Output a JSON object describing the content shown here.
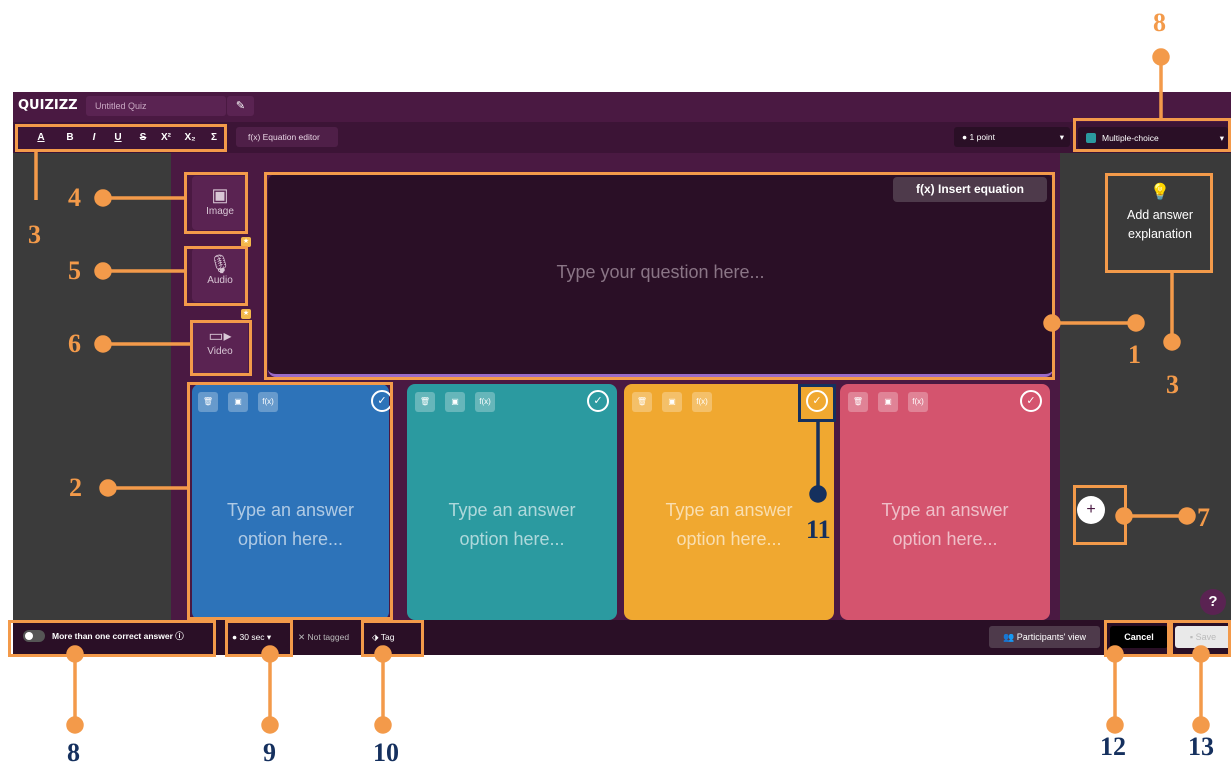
{
  "header": {
    "logo": "QUIZIZZ",
    "quiz_title": "Untitled Quiz",
    "edit_icon": "pencil-icon"
  },
  "toolbar": {
    "format_buttons": [
      "A",
      "B",
      "I",
      "U",
      "S",
      "X²",
      "X₂",
      "Σ"
    ],
    "equation_editor": "Equation editor",
    "points": "1 point",
    "question_type": "Multiple-choice"
  },
  "media": {
    "image": "Image",
    "audio": "Audio",
    "video": "Video"
  },
  "question": {
    "placeholder": "Type your question here...",
    "insert_equation": "Insert equation"
  },
  "explanation": {
    "label_line1": "Add answer",
    "label_line2": "explanation"
  },
  "answers": [
    {
      "line1": "Type an answer",
      "line2": "option here...",
      "color": "#2d73b9"
    },
    {
      "line1": "Type an answer",
      "line2": "option here...",
      "color": "#2b9aa0"
    },
    {
      "line1": "Type an answer",
      "line2": "option here...",
      "color": "#f0a830"
    },
    {
      "line1": "Type an answer",
      "line2": "option here...",
      "color": "#d4546e"
    }
  ],
  "bottom": {
    "more_than_one": "More than one correct answer",
    "time": "30 sec",
    "not_tagged": "Not tagged",
    "tag": "Tag",
    "participants_view": "Participants' view",
    "cancel": "Cancel",
    "save": "Save",
    "help": "?"
  },
  "callouts": {
    "n1": "1",
    "n2": "2",
    "n3a": "3",
    "n3b": "3",
    "n4": "4",
    "n5": "5",
    "n6": "6",
    "n7": "7",
    "n8a": "8",
    "n8b": "8",
    "n9": "9",
    "n10": "10",
    "n11": "11",
    "n12": "12",
    "n13": "13"
  },
  "colors": {
    "callout": "#f39a4a",
    "callout_dark": "#15305e",
    "brand_purple": "#4a1942"
  }
}
